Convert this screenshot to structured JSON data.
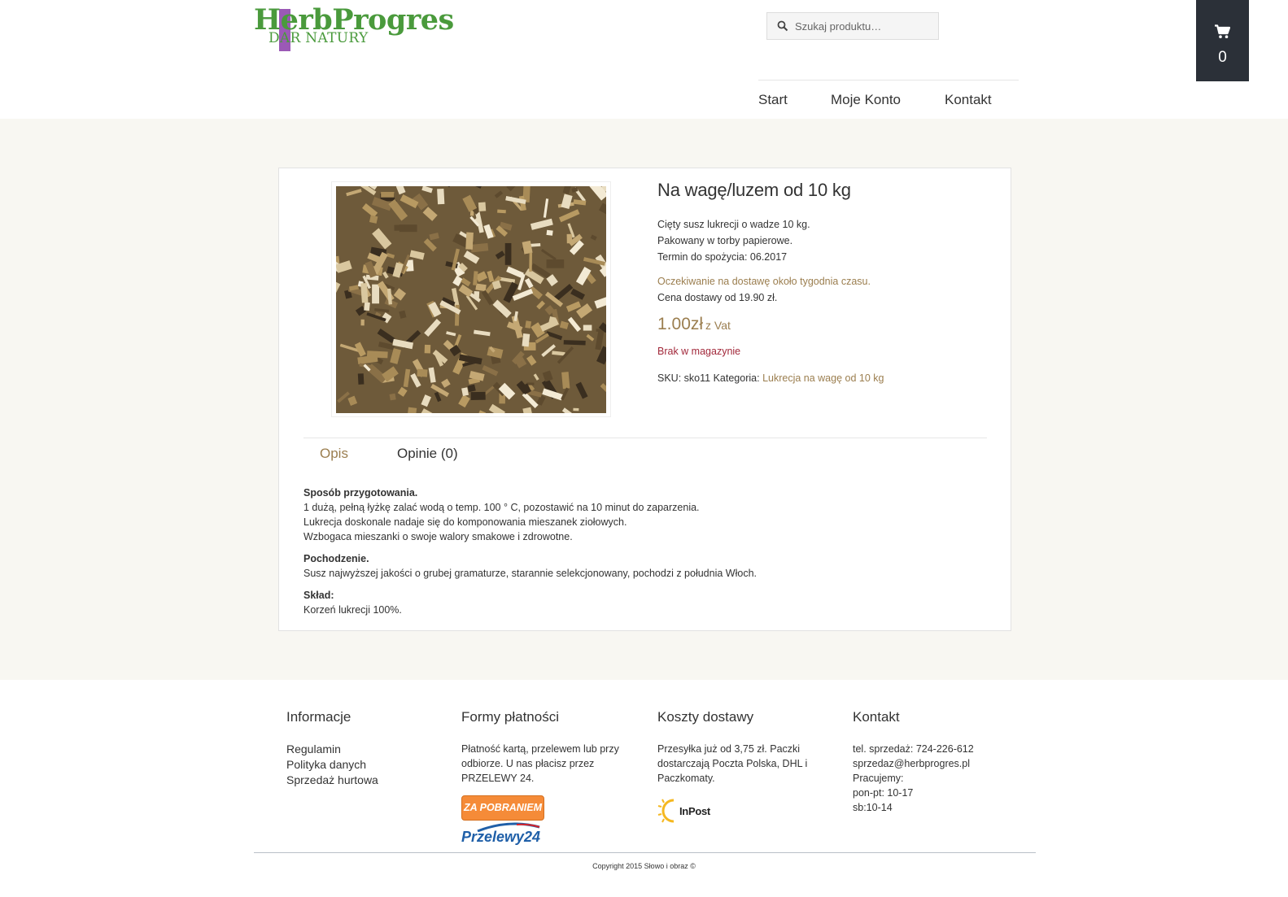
{
  "logo": {
    "main_before": "H",
    "main_mid": "e",
    "main_after": "rbProgres",
    "sub": "DAR NATURY"
  },
  "search": {
    "placeholder": "Szukaj produktu…"
  },
  "nav": {
    "items": [
      "Start",
      "Moje Konto",
      "Kontakt"
    ]
  },
  "cart": {
    "count": "0"
  },
  "product": {
    "title": "Na wagę/luzem od 10 kg",
    "desc": [
      "Cięty susz lukrecji o wadze 10 kg.",
      "Pakowany w torby papierowe.",
      "Termin do spożycia: 06.2017"
    ],
    "wait": "Oczekiwanie na dostawę około tygodnia czasu.",
    "shipping": "Cena dostawy od 19.90 zł.",
    "price": "1.00zł",
    "vat": "z Vat",
    "stock": "Brak w magazynie",
    "sku_label": "SKU:",
    "sku": "sko11",
    "category_label": "Kategoria:",
    "category": "Lukrecja na wagę od 10 kg"
  },
  "tabs": [
    {
      "label": "Opis",
      "active": true
    },
    {
      "label": "Opinie (0)",
      "active": false
    }
  ],
  "description": {
    "prep_title": "Sposób przygotowania.",
    "prep": [
      "1 dużą, pełną łyżkę zalać wodą o temp. 100 ° C, pozostawić na 10 minut do zaparzenia.",
      "Lukrecja doskonale nadaje się do komponowania mieszanek ziołowych.",
      "Wzbogaca mieszanki o swoje walory smakowe i zdrowotne."
    ],
    "origin_title": "Pochodzenie.",
    "origin": "Susz najwyższej jakości o grubej gramaturze, starannie selekcjonowany, pochodzi z południa Włoch.",
    "comp_title": "Skład:",
    "comp": "Korzeń lukrecji 100%."
  },
  "footer": {
    "info": {
      "title": "Informacje",
      "links": [
        "Regulamin",
        "Polityka danych",
        "Sprzedaż hurtowa"
      ]
    },
    "payment": {
      "title": "Formy płatności",
      "text": [
        "Płatność kartą, przelewem lub przy",
        "odbiorze. U nas płacisz przez",
        "PRZELEWY 24."
      ],
      "cod_badge": "ZA POBRANIEM",
      "p24_logo": "Przelewy24"
    },
    "shipping": {
      "title": "Koszty dostawy",
      "text": [
        "Przesyłka już od 3,75 zł. Paczki",
        "dostarczają Poczta Polska, DHL i",
        "Paczkomaty."
      ],
      "inpost_logo": "InPost"
    },
    "contact": {
      "title": "Kontakt",
      "lines": [
        "tel. sprzedaż: 724-226-612",
        "sprzedaz@herbprogres.pl",
        "Pracujemy:",
        "pon-pt: 10-17",
        "sb:10-14"
      ]
    },
    "copyright": "Copyright 2015 Słowo i obraz ©"
  },
  "colors": {
    "accent": "#9b7e4f",
    "out_of_stock": "#a2293b",
    "cart_bg": "#2b3038",
    "logo_green": "#4a9a3c",
    "logo_purple": "#9b59b6"
  }
}
